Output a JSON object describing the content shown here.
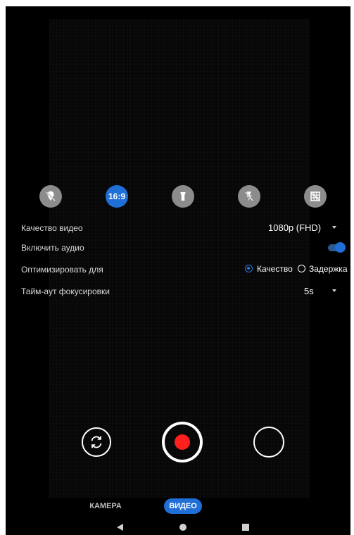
{
  "quick_settings": {
    "icons": [
      "location-off-icon",
      "aspect-ratio",
      "torch-icon",
      "flash-off-icon",
      "grid-off-icon"
    ],
    "aspect_ratio_label": "16:9"
  },
  "settings": {
    "video_quality": {
      "label": "Качество видео",
      "value": "1080p (FHD)"
    },
    "enable_audio": {
      "label": "Включить аудио",
      "enabled": true
    },
    "optimize_for": {
      "label": "Оптимизировать для",
      "options": [
        {
          "label": "Качество",
          "selected": true
        },
        {
          "label": "Задержка",
          "selected": false
        }
      ]
    },
    "focus_timeout": {
      "label": "Тайм-аут фокусировки",
      "value": "5s"
    }
  },
  "capture": {
    "icons": [
      "switch-camera-icon",
      "record-icon",
      "gallery-thumbnail"
    ]
  },
  "modes": {
    "camera": "КАМЕРА",
    "video": "ВИДЕО",
    "active": "video"
  },
  "colors": {
    "accent": "#1f6fd6",
    "record": "#ff1f1f",
    "background": "#000000"
  }
}
